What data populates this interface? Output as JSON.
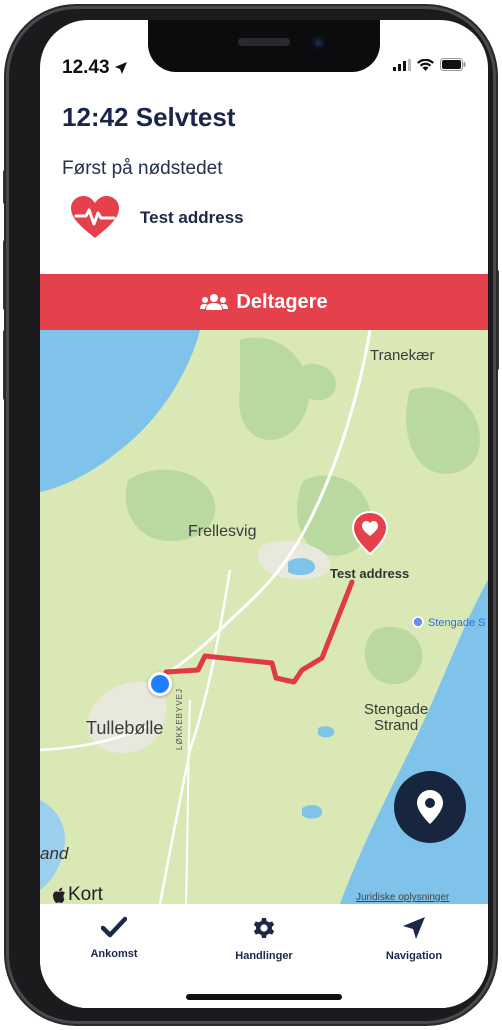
{
  "status_bar": {
    "time": "12.43"
  },
  "header": {
    "title": "12:42 Selvtest",
    "subtitle": "Først på nødstedet",
    "address": "Test address"
  },
  "participants_button": {
    "label": "Deltagere"
  },
  "map": {
    "labels": {
      "tranekaer": "Tranekær",
      "frellesvig": "Frellesvig",
      "test_address": "Test address",
      "stengade_poi": "Stengade S",
      "stengade_strand_1": "Stengade",
      "stengade_strand_2": "Strand",
      "tullebolle": "Tullebølle",
      "lokkebyvej": "LØKKEBYVEJ",
      "and": "and",
      "attribution": "Kort",
      "legal": "Juridiske oplysninger"
    }
  },
  "tabbar": {
    "tabs": [
      {
        "label": "Ankomst",
        "icon": "checkmark-icon"
      },
      {
        "label": "Handlinger",
        "icon": "gear-icon"
      },
      {
        "label": "Navigation",
        "icon": "navigation-arrow-icon"
      }
    ]
  },
  "colors": {
    "accent_red": "#e5414c",
    "navy": "#19264a",
    "route": "#e03a44",
    "user_location": "#1f7fff",
    "water": "#7fc3ea",
    "land": "#d9e8b5"
  }
}
